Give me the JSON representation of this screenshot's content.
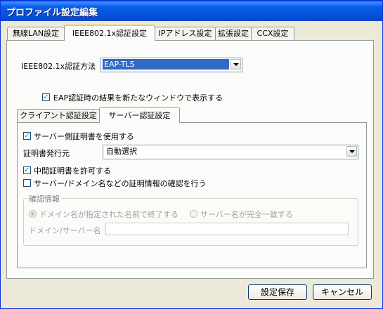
{
  "window": {
    "title": "プロファイル設定編集"
  },
  "tabs": [
    {
      "label": "無線LAN設定"
    },
    {
      "label": "IEEE802.1x認証設定",
      "active": true
    },
    {
      "label": "IPアドレス設定"
    },
    {
      "label": "拡張設定"
    },
    {
      "label": "CCX設定"
    }
  ],
  "auth": {
    "method_label": "IEEE802.1x認証方法",
    "method_value": "EAP-TLS",
    "eap_window_label": "EAP認証時の結果を新たなウィンドウで表示する",
    "eap_window_checked": true
  },
  "subtabs": [
    {
      "label": "クライアント認証設定"
    },
    {
      "label": "サーバー認証設定",
      "active": true
    }
  ],
  "server": {
    "use_server_cert_label": "サーバー側証明書を使用する",
    "use_server_cert_checked": true,
    "issuer_label": "証明書発行元",
    "issuer_value": "自動選択",
    "allow_intermediate_label": "中間証明書を許可する",
    "allow_intermediate_checked": true,
    "verify_label": "サーバー/ドメイン名などの証明情報の確認を行う",
    "verify_checked": false,
    "group_title": "確認情報",
    "radio_domain_label": "ドメイン名が指定された名前で終了する",
    "radio_server_label": "サーバー名が完全一致する",
    "domain_server_label": "ドメイン/サーバー名",
    "domain_server_value": ""
  },
  "buttons": {
    "save": "設定保存",
    "cancel": "キャンセル"
  }
}
